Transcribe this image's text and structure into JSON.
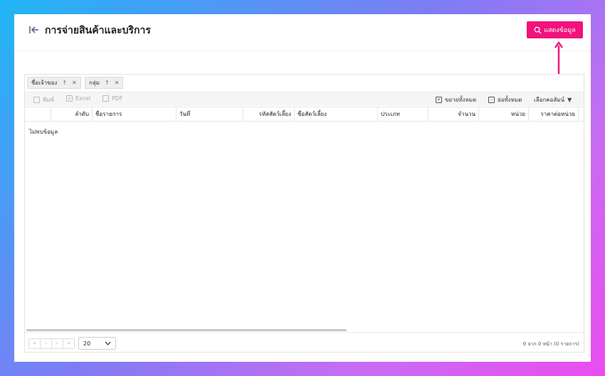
{
  "header": {
    "title": "การจ่ายสินค้าและบริการ",
    "show_button_label": "แสดงข้อมูล"
  },
  "group_panel": {
    "chips": [
      {
        "label": "ชื่อเจ้าของ"
      },
      {
        "label": "กลุ่ม"
      }
    ]
  },
  "toolbar": {
    "print_label": "พิมพ์",
    "excel_label": "Excel",
    "pdf_label": "PDF",
    "expand_all_label": "ขยายทั้งหมด",
    "collapse_all_label": "ย่อทั้งหมด",
    "choose_columns_label": "เลือกคอลัมน์"
  },
  "table": {
    "columns": [
      "ลำดับ",
      "ชื่อรายการ",
      "วันที่",
      "รหัสสัตว์เลี้ยง",
      "ชื่อสัตว์เลี้ยง",
      "ประเภท",
      "จำนวน",
      "หน่วย",
      "ราคาต่อหน่วย"
    ],
    "empty_text": "ไม่พบข้อมูล"
  },
  "pager": {
    "buttons": [
      "«",
      "‹",
      "›",
      "»"
    ],
    "page_size": "20",
    "info": "0 จาก 0 หน้า (0 รายการ)"
  },
  "colors": {
    "accent": "#f0147c"
  }
}
